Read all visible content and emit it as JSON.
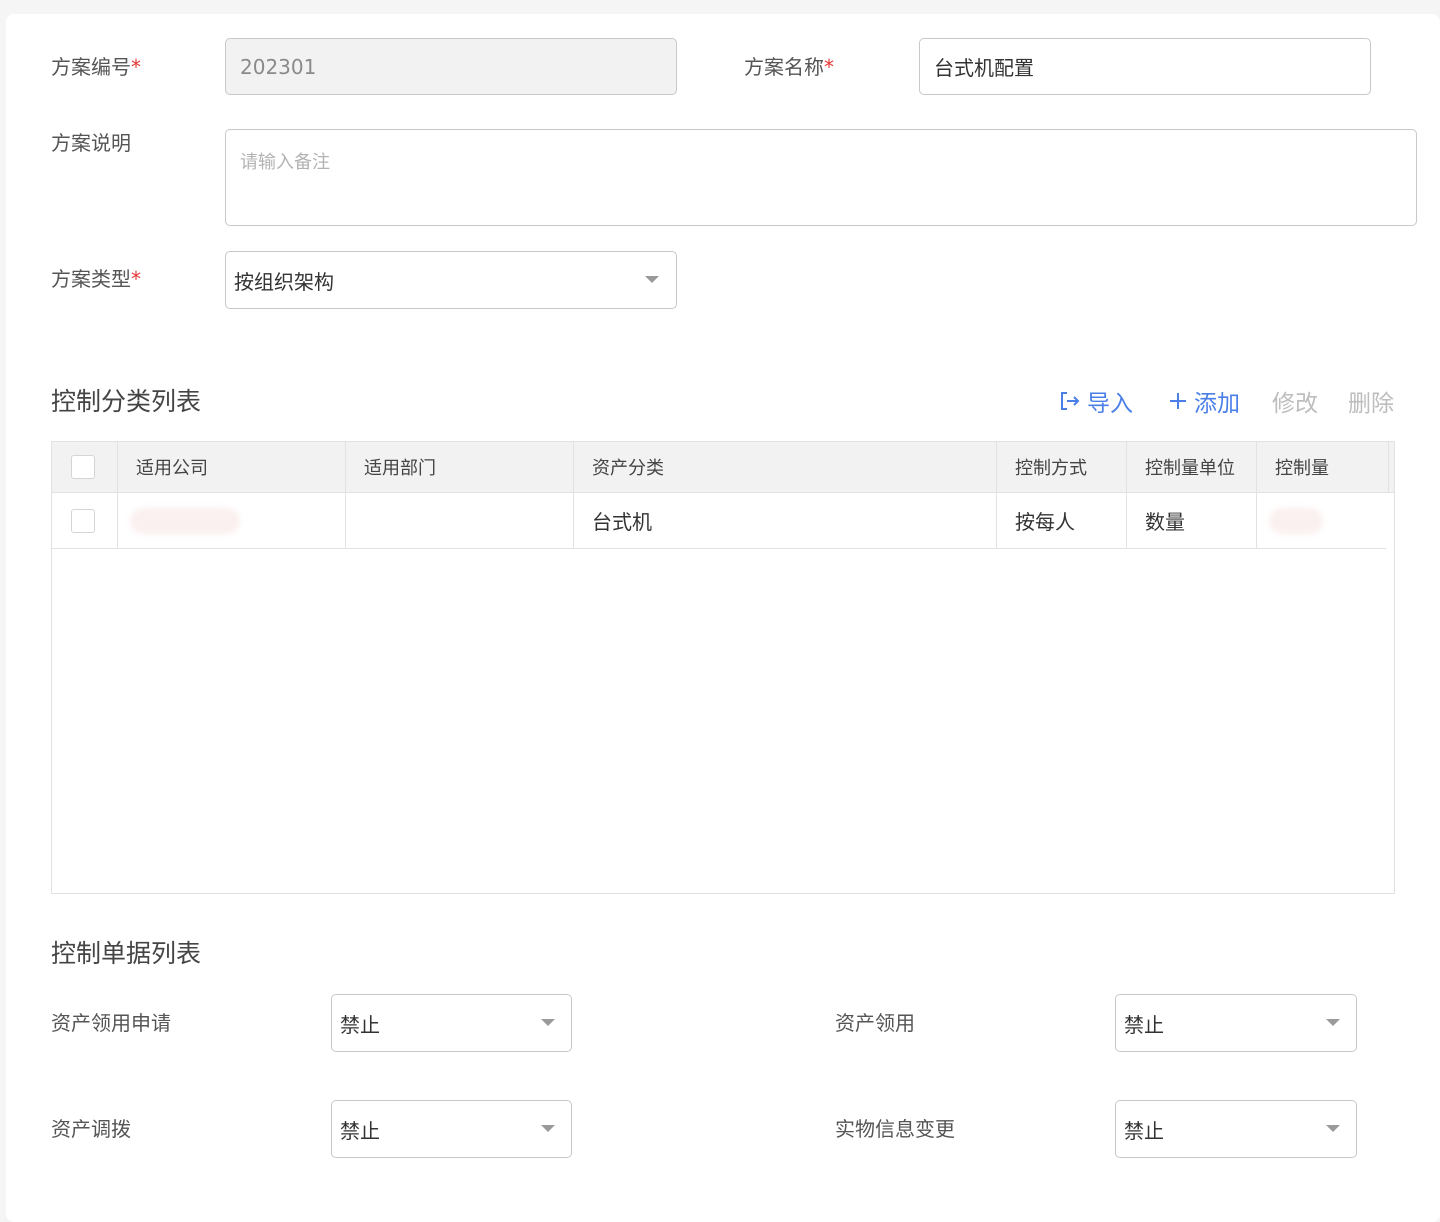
{
  "form": {
    "code_label": "方案编号",
    "code_value": "202301",
    "name_label": "方案名称",
    "name_value": "台式机配置",
    "desc_label": "方案说明",
    "desc_placeholder": "请输入备注",
    "type_label": "方案类型",
    "type_value": "按组织架构",
    "required_mark": "*"
  },
  "category_list": {
    "title": "控制分类列表",
    "actions": {
      "import": "导入",
      "add": "添加",
      "edit": "修改",
      "delete": "删除"
    },
    "columns": [
      "适用公司",
      "适用部门",
      "资产分类",
      "控制方式",
      "控制量单位",
      "控制量"
    ],
    "rows": [
      {
        "company": "",
        "department": "",
        "category": "台式机",
        "method": "按每人",
        "unit": "数量",
        "amount": ""
      }
    ]
  },
  "document_list": {
    "title": "控制单据列表",
    "items": [
      {
        "label": "资产领用申请",
        "value": "禁止"
      },
      {
        "label": "资产领用",
        "value": "禁止"
      },
      {
        "label": "资产调拨",
        "value": "禁止"
      },
      {
        "label": "实物信息变更",
        "value": "禁止"
      }
    ]
  },
  "colors": {
    "accent": "#4a7fe8",
    "required": "#e53935",
    "disabled_action": "#bdbdbd"
  }
}
